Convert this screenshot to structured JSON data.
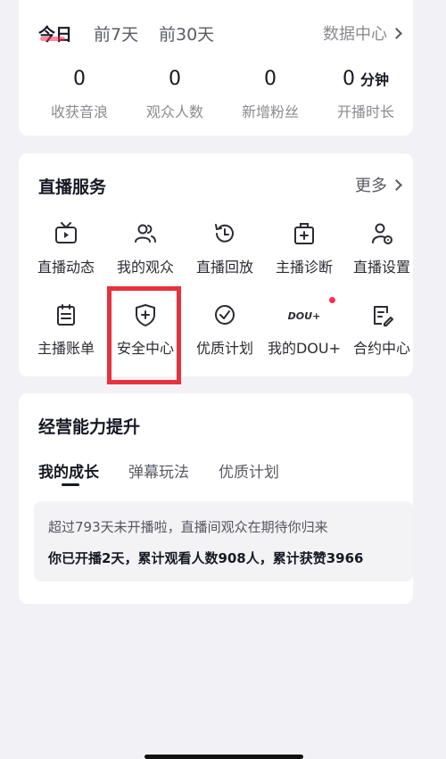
{
  "stats": {
    "tabs": [
      {
        "label": "今日",
        "active": true
      },
      {
        "label": "前7天",
        "active": false
      },
      {
        "label": "前30天",
        "active": false
      }
    ],
    "data_center_label": "数据中心",
    "items": [
      {
        "value": "0",
        "unit": "",
        "label": "收获音浪"
      },
      {
        "value": "0",
        "unit": "",
        "label": "观众人数"
      },
      {
        "value": "0",
        "unit": "",
        "label": "新增粉丝"
      },
      {
        "value": "0",
        "unit": "分钟",
        "label": "开播时长"
      }
    ]
  },
  "services": {
    "title": "直播服务",
    "more_label": "更多",
    "items": [
      {
        "label": "直播动态",
        "icon": "tv-icon"
      },
      {
        "label": "我的观众",
        "icon": "audience-icon"
      },
      {
        "label": "直播回放",
        "icon": "replay-icon"
      },
      {
        "label": "主播诊断",
        "icon": "diagnosis-icon"
      },
      {
        "label": "直播设置",
        "icon": "settings-user-icon"
      },
      {
        "label": "主播账单",
        "icon": "bill-icon"
      },
      {
        "label": "安全中心",
        "icon": "shield-icon"
      },
      {
        "label": "优质计划",
        "icon": "check-badge-icon"
      },
      {
        "label": "我的DOU+",
        "icon": "dou-logo-icon",
        "logo_text": "DOU+",
        "badge": true
      },
      {
        "label": "合约中心",
        "icon": "contract-icon"
      }
    ],
    "highlight_color": "#e6323d"
  },
  "ability": {
    "title": "经营能力提升",
    "tabs": [
      {
        "label": "我的成长",
        "active": true
      },
      {
        "label": "弹幕玩法",
        "active": false
      },
      {
        "label": "优质计划",
        "active": false
      }
    ],
    "growth_line1": "超过793天未开播啦，直播间观众在期待你归来",
    "growth_line2": "你已开播2天，累计观看人数908人，累计获赞3966"
  },
  "colors": {
    "background": "#f2f2f6",
    "accent": "#fe2c55",
    "card": "#ffffff"
  }
}
